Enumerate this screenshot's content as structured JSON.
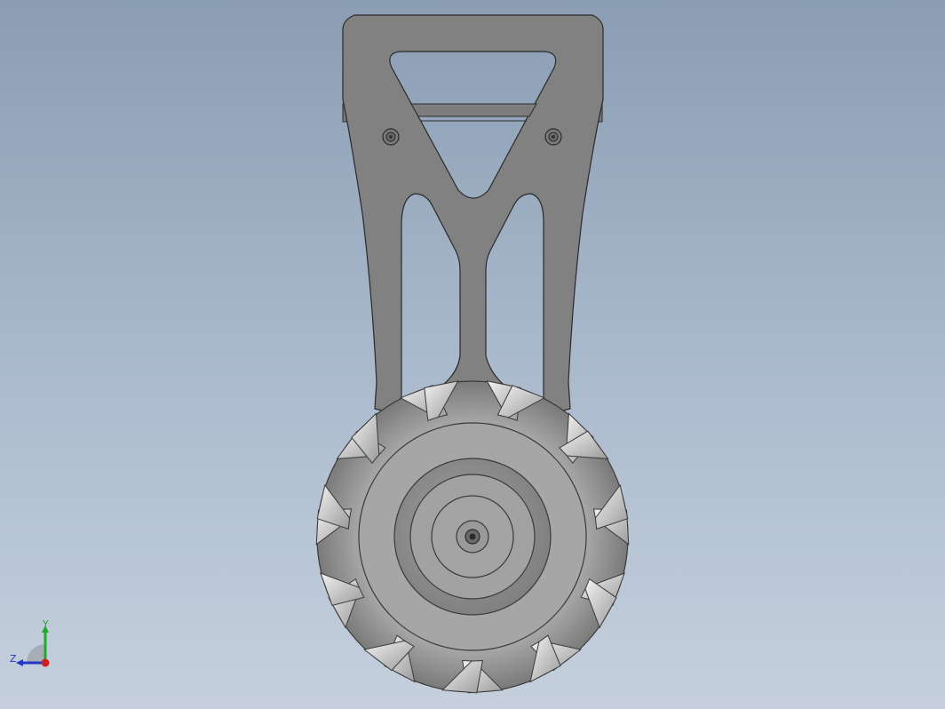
{
  "viewport": {
    "background_top": "#8a9db3",
    "background_bottom": "#c6d0dd"
  },
  "model": {
    "bracket_color": "#818181",
    "bracket_edge": "#2a2a2a",
    "wheel_color": "#a8a8a8",
    "hub_color": "#909090",
    "tread_highlight": "#e8e8e8"
  },
  "triad": {
    "y_label": "Y",
    "z_label": "Z",
    "y_color": "#1faa2a",
    "z_color": "#2238c8",
    "x_color": "#d02020"
  }
}
